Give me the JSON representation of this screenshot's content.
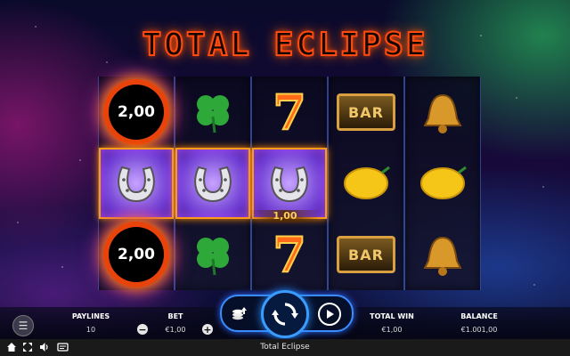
{
  "game": {
    "title": "TOTAL ECLIPSE",
    "window_title": "Total Eclipse"
  },
  "reels": [
    [
      {
        "symbol": "eclipse-orb",
        "value": "2,00"
      },
      {
        "symbol": "horseshoe",
        "win": true
      },
      {
        "symbol": "eclipse-orb",
        "value": "2,00"
      }
    ],
    [
      {
        "symbol": "clover"
      },
      {
        "symbol": "horseshoe",
        "win": true
      },
      {
        "symbol": "clover"
      }
    ],
    [
      {
        "symbol": "seven"
      },
      {
        "symbol": "horseshoe",
        "win": true
      },
      {
        "symbol": "seven"
      }
    ],
    [
      {
        "symbol": "bar"
      },
      {
        "symbol": "lemon"
      },
      {
        "symbol": "bar"
      }
    ],
    [
      {
        "symbol": "bell"
      },
      {
        "symbol": "lemon"
      },
      {
        "symbol": "bell"
      }
    ]
  ],
  "symbols": {
    "bar_text": "BAR",
    "seven_text": "7",
    "orb_1": "2,00",
    "orb_2": "2,00"
  },
  "line_win": "1,00",
  "panel": {
    "paylines_label": "PAYLINES",
    "paylines_value": "10",
    "bet_label": "BET",
    "bet_value": "€1,00",
    "total_win_label": "TOTAL WIN",
    "total_win_value": "€1,00",
    "balance_label": "BALANCE",
    "balance_value": "€1.001,00",
    "minus": "−",
    "plus": "+"
  },
  "colors": {
    "accent": "#3a9cff",
    "title": "#ff4a10",
    "win_frame": "#ff9a1a"
  },
  "icons": [
    "menu-icon",
    "coins-icon",
    "spin-icon",
    "autoplay-icon",
    "home-icon",
    "fullscreen-icon",
    "sound-icon",
    "paytable-icon"
  ]
}
